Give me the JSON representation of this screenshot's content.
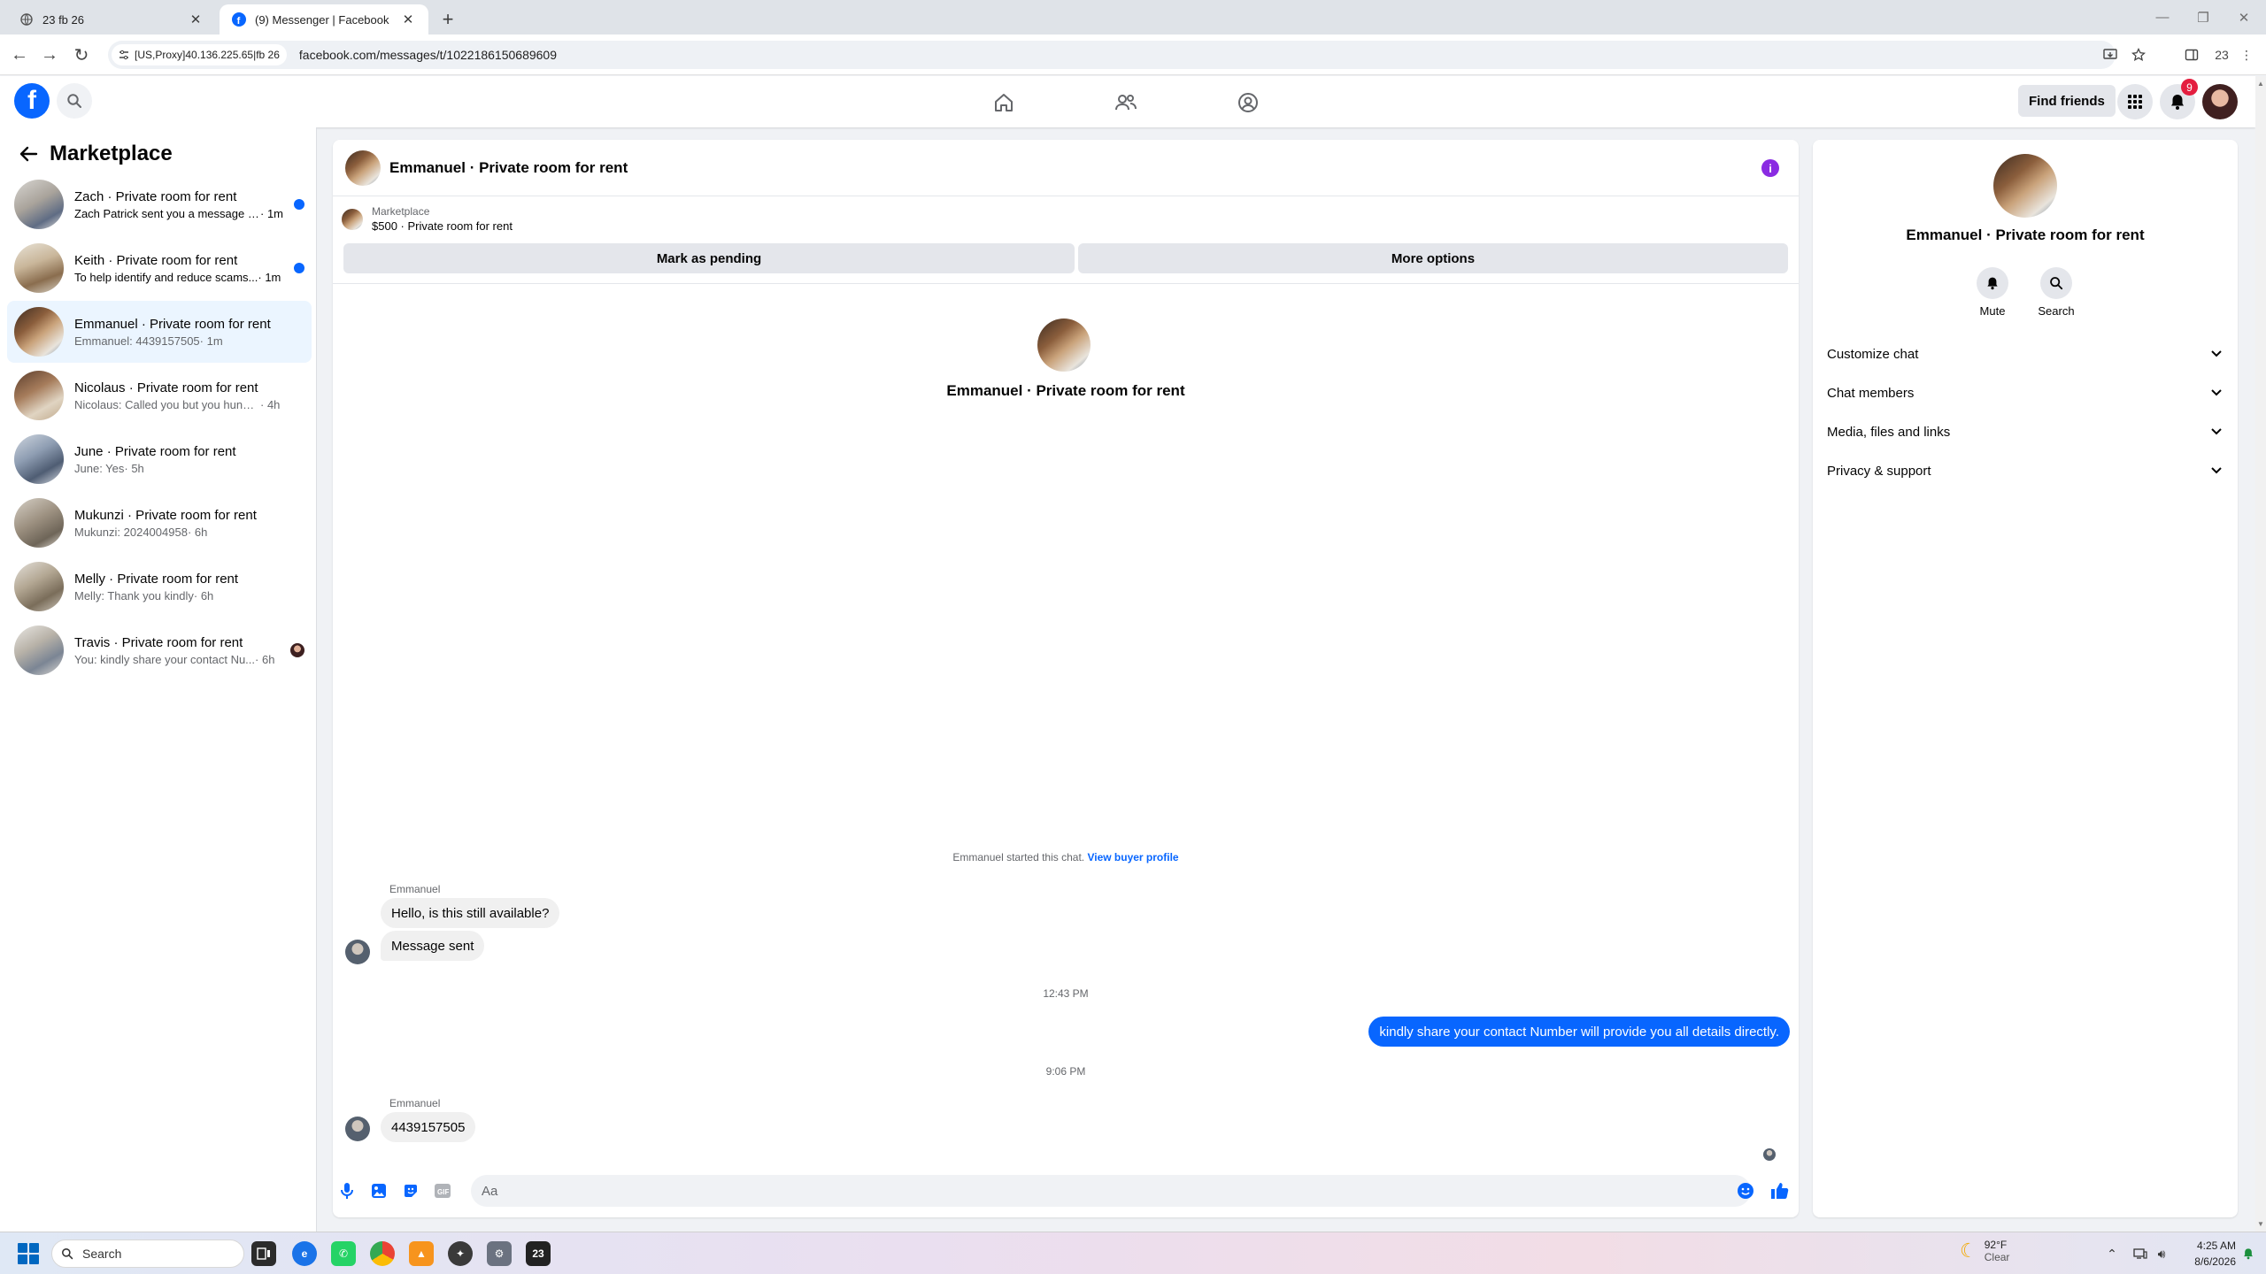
{
  "browser": {
    "tabs": [
      {
        "title": "23 fb 26",
        "active": false
      },
      {
        "title": "(9) Messenger | Facebook",
        "active": true
      }
    ],
    "site_chip": "[US,Proxy]40.136.225.65|fb 26",
    "url": "facebook.com/messages/t/1022186150689609",
    "profile_count": "23"
  },
  "fb": {
    "find_friends": "Find friends",
    "notification_count": "9"
  },
  "sidebar": {
    "title": "Marketplace",
    "conversations": [
      {
        "name": "Zach · Private room for rent",
        "preview": "Zach Patrick sent you a message a...",
        "time": "· 1m",
        "unread": true,
        "selected": false
      },
      {
        "name": "Keith · Private room for rent",
        "preview": "To help identify and reduce scams...",
        "time": "· 1m",
        "unread": true,
        "selected": false
      },
      {
        "name": "Emmanuel · Private room for rent",
        "preview": "Emmanuel: 4439157505",
        "time": "· 1m",
        "unread": false,
        "selected": true
      },
      {
        "name": "Nicolaus · Private room for rent",
        "preview": "Nicolaus: Called you but you hung up...",
        "time": "· 4h",
        "unread": false,
        "selected": false
      },
      {
        "name": "June · Private room for rent",
        "preview": "June: Yes",
        "time": "· 5h",
        "unread": false,
        "selected": false
      },
      {
        "name": "Mukunzi · Private room for rent",
        "preview": "Mukunzi: 2024004958",
        "time": "· 6h",
        "unread": false,
        "selected": false
      },
      {
        "name": "Melly · Private room for rent",
        "preview": "Melly: Thank you kindly",
        "time": "· 6h",
        "unread": false,
        "selected": false
      },
      {
        "name": "Travis · Private room for rent",
        "preview": "You: kindly share your contact Nu...",
        "time": "· 6h",
        "unread": false,
        "selected": false
      }
    ]
  },
  "chat": {
    "title": "Emmanuel · Private room for rent",
    "listing_source": "Marketplace",
    "listing_detail": "$500 · Private room for rent",
    "mark_pending": "Mark as pending",
    "more_options": "More options",
    "intro_name": "Emmanuel · Private room for rent",
    "started_text": "Emmanuel started this chat.",
    "view_buyer": "View buyer profile",
    "sender_name_1": "Emmanuel",
    "msg_1": "Hello, is this still available?",
    "msg_2": "Message sent",
    "time_1": "12:43 PM",
    "msg_out": "kindly share your contact Number will provide you all details directly.",
    "time_2": "9:06 PM",
    "sender_name_2": "Emmanuel",
    "msg_3": "4439157505",
    "composer_placeholder": "Aa"
  },
  "panel": {
    "name": "Emmanuel · Private room for rent",
    "mute": "Mute",
    "search": "Search",
    "sections": [
      "Customize chat",
      "Chat members",
      "Media, files and links",
      "Privacy & support"
    ]
  },
  "taskbar": {
    "search": "Search",
    "temp": "92°F",
    "weather": "Clear",
    "time": "4:25 AM",
    "date": "8/6/2026",
    "app_badge": "23"
  },
  "colors": {
    "brand": "#0866ff",
    "selected_row": "#ebf5ff",
    "badge": "#e41e3f",
    "info": "#8a2be2"
  }
}
